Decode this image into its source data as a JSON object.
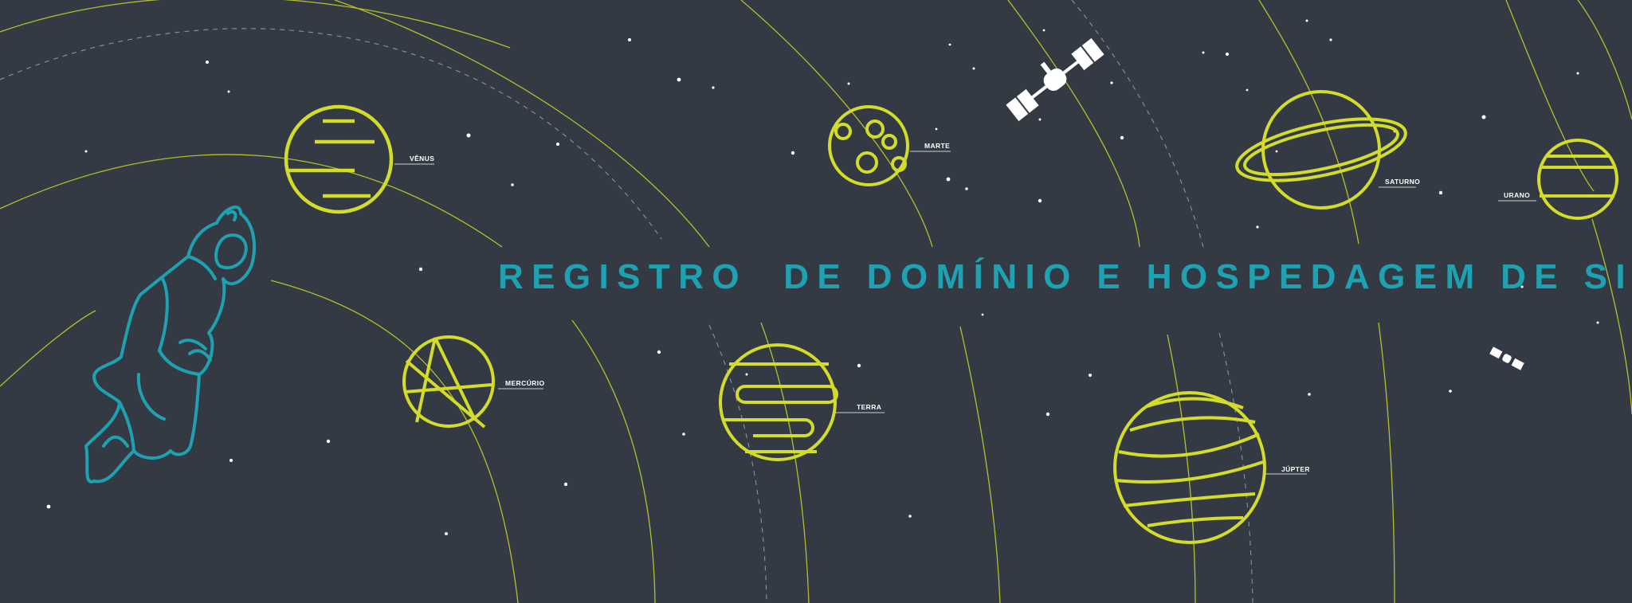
{
  "banner": {
    "headline": "REGISTRO  DE DOMÍNIO E HOSPEDAGEM DE SITE"
  },
  "planets": {
    "venus": "VÊNUS",
    "mercurio": "MERCÚRIO",
    "marte": "MARTE",
    "terra": "TERRA",
    "jupiter": "JÚPTER",
    "saturno": "SATURNO",
    "urano": "URANO"
  },
  "decorations": [
    "astronaut-icon",
    "satellite-icon",
    "small-satellite-icon"
  ],
  "colors": {
    "background": "#333a44",
    "planet": "#d4dc2a",
    "orbit": "#b5c02a",
    "headline": "#1ea1b1",
    "astronaut": "#1ea1b1",
    "stars": "#ffffff"
  }
}
